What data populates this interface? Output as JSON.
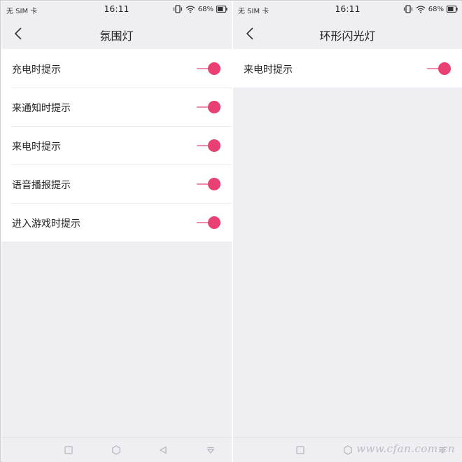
{
  "colors": {
    "accent": "#ea3f73",
    "track": "#f189a9",
    "background": "#efeff3"
  },
  "left": {
    "status": {
      "sim": "无 SIM 卡",
      "time": "16:11",
      "battery": "68%"
    },
    "header": {
      "title": "氛围灯"
    },
    "items": [
      {
        "label": "充电时提示",
        "on": true
      },
      {
        "label": "来通知时提示",
        "on": true
      },
      {
        "label": "来电时提示",
        "on": true
      },
      {
        "label": "语音播报提示",
        "on": true
      },
      {
        "label": "进入游戏时提示",
        "on": true
      }
    ]
  },
  "right": {
    "status": {
      "sim": "无 SIM 卡",
      "time": "16:11",
      "battery": "68%"
    },
    "header": {
      "title": "环形闪光灯"
    },
    "items": [
      {
        "label": "来电时提示",
        "on": true
      }
    ]
  },
  "watermark": "www.cfan.com.cn"
}
